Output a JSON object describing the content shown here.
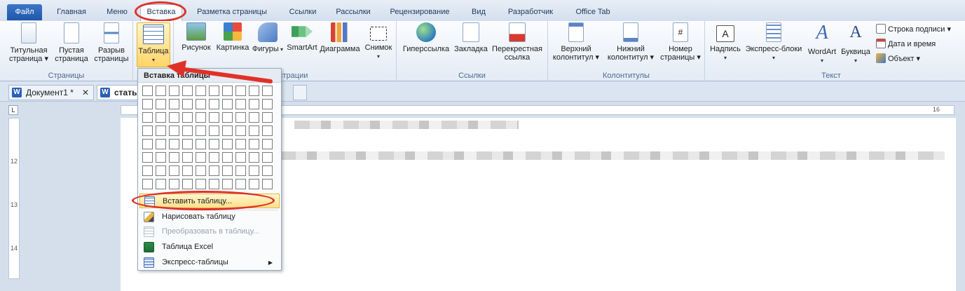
{
  "tabs": {
    "file": "Файл",
    "home": "Главная",
    "menu": "Меню",
    "insert": "Вставка",
    "layout": "Разметка страницы",
    "refs": "Ссылки",
    "mail": "Рассылки",
    "review": "Рецензирование",
    "view": "Вид",
    "dev": "Разработчик",
    "officetab": "Office Tab"
  },
  "ribbon": {
    "pages": {
      "label": "Страницы",
      "cover": [
        "Титульная",
        "страница ▾"
      ],
      "blank": [
        "Пустая",
        "страница"
      ],
      "break": [
        "Разрыв",
        "страницы"
      ]
    },
    "tables": {
      "table": "Таблица"
    },
    "illus": {
      "label": "страции",
      "picture": "Рисунок",
      "clip": "Картинка",
      "shapes": "Фигуры",
      "smartart": "SmartArt",
      "chart": "Диаграмма",
      "snapshot": "Снимок"
    },
    "links": {
      "label": "Ссылки",
      "hyperlink": "Гиперссылка",
      "bookmark": "Закладка",
      "crossref": [
        "Перекрестная",
        "ссылка"
      ]
    },
    "hf": {
      "label": "Колонтитулы",
      "header": [
        "Верхний",
        "колонтитул ▾"
      ],
      "footer": [
        "Нижний",
        "колонтитул ▾"
      ],
      "pagenum": [
        "Номер",
        "страницы ▾"
      ]
    },
    "text": {
      "label": "Текст",
      "textbox": "Надпись",
      "quick": "Экспресс-блоки",
      "wordart": "WordArt",
      "dropcap": "Буквица",
      "sigline": "Строка подписи ▾",
      "datetime": "Дата и время",
      "object": "Объект ▾"
    }
  },
  "doctabs": {
    "doc1": "Документ1 *",
    "doc2": "статья"
  },
  "dropdown": {
    "header": "Вставка таблицы",
    "insert_table": "Вставить таблицу...",
    "draw_table": "Нарисовать таблицу",
    "convert": "Преобразовать в таблицу...",
    "excel": "Таблица Excel",
    "quick_tables": "Экспресс-таблицы"
  },
  "ruler": {
    "v12": "12",
    "v13": "13",
    "v14": "14",
    "h16": "16"
  },
  "colors": {
    "accent": "#e03128",
    "file_tab": "#2b5fb4"
  }
}
